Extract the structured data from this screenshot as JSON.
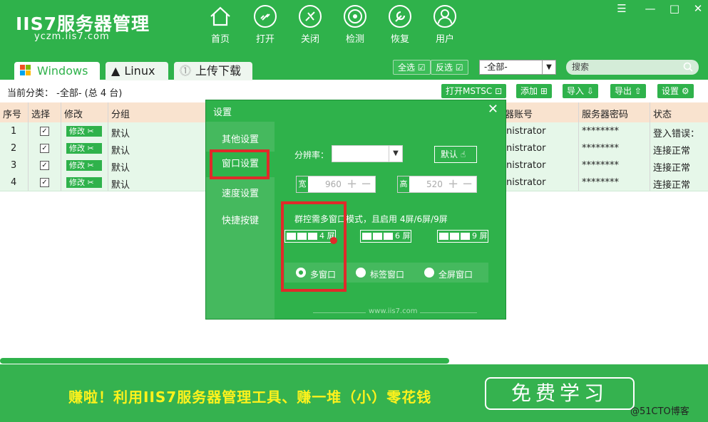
{
  "app": {
    "logo": "IIS7服务器管理",
    "subtitle": "yczm.iis7.com"
  },
  "nav": [
    {
      "label": "首页",
      "icon": "home-icon"
    },
    {
      "label": "打开",
      "icon": "link-icon"
    },
    {
      "label": "关闭",
      "icon": "unlink-icon"
    },
    {
      "label": "检测",
      "icon": "radar-icon"
    },
    {
      "label": "恢复",
      "icon": "wrench-icon"
    },
    {
      "label": "用户",
      "icon": "user-icon"
    }
  ],
  "window_controls": {
    "menu": "☰",
    "minimize": "—",
    "maximize": "□",
    "close": "✕"
  },
  "tabs": [
    {
      "label": "Windows"
    },
    {
      "label": "Linux"
    },
    {
      "label": "上传下载"
    }
  ],
  "toolbar": {
    "select_all": "全选",
    "invert": "反选",
    "filter_value": "-全部-",
    "search_placeholder": "搜索"
  },
  "category": {
    "text": "当前分类： -全部- (总 4 台)"
  },
  "actions": {
    "mstsc": "打开MSTSC",
    "add": "添加",
    "import": "导入",
    "export": "导出",
    "settings": "设置"
  },
  "table": {
    "headers": {
      "no": "序号",
      "select": "选择",
      "edit": "修改",
      "group": "分组",
      "account": "器账号",
      "password": "服务器密码",
      "status": "状态"
    },
    "edit_label": "修改",
    "rows": [
      {
        "no": "1",
        "group": "默认",
        "account": "nistrator",
        "password": "********",
        "status": "登入错误："
      },
      {
        "no": "2",
        "group": "默认",
        "account": "nistrator",
        "password": "********",
        "status": "连接正常"
      },
      {
        "no": "3",
        "group": "默认",
        "account": "nistrator",
        "password": "********",
        "status": "连接正常"
      },
      {
        "no": "4",
        "group": "默认",
        "account": "nistrator",
        "password": "********",
        "status": "连接正常"
      }
    ]
  },
  "dialog": {
    "title": "设置",
    "close": "✕",
    "menu": [
      {
        "label": "其他设置"
      },
      {
        "label": "窗口设置"
      },
      {
        "label": "速度设置"
      },
      {
        "label": "快捷按键"
      }
    ],
    "resolution_label": "分辨率：",
    "default_btn": "默认",
    "width_label": "宽",
    "width_value": "960",
    "height_label": "高",
    "height_value": "520",
    "group_text": "群控需多窗口模式，且启用 4屏/6屏/9屏",
    "screens": [
      {
        "label": "4 屏"
      },
      {
        "label": "6 屏"
      },
      {
        "label": "9 屏"
      }
    ],
    "window_modes": [
      {
        "label": "多窗口",
        "checked": true
      },
      {
        "label": "标签窗口",
        "checked": false
      },
      {
        "label": "全屏窗口",
        "checked": false
      }
    ],
    "footer": "www.iis7.com"
  },
  "banner": {
    "part1": "赚啦！利用IIS7服务器管理工具、赚一堆（小）",
    "part2": "零花钱",
    "cta": "免费学习"
  },
  "watermark": "@51CTO博客",
  "colors": {
    "primary": "#2fb24b",
    "header_row": "#f9e3cf",
    "row_bg": "#e6f7e9",
    "highlight": "#e02a2a",
    "banner_text": "#fff21c"
  }
}
